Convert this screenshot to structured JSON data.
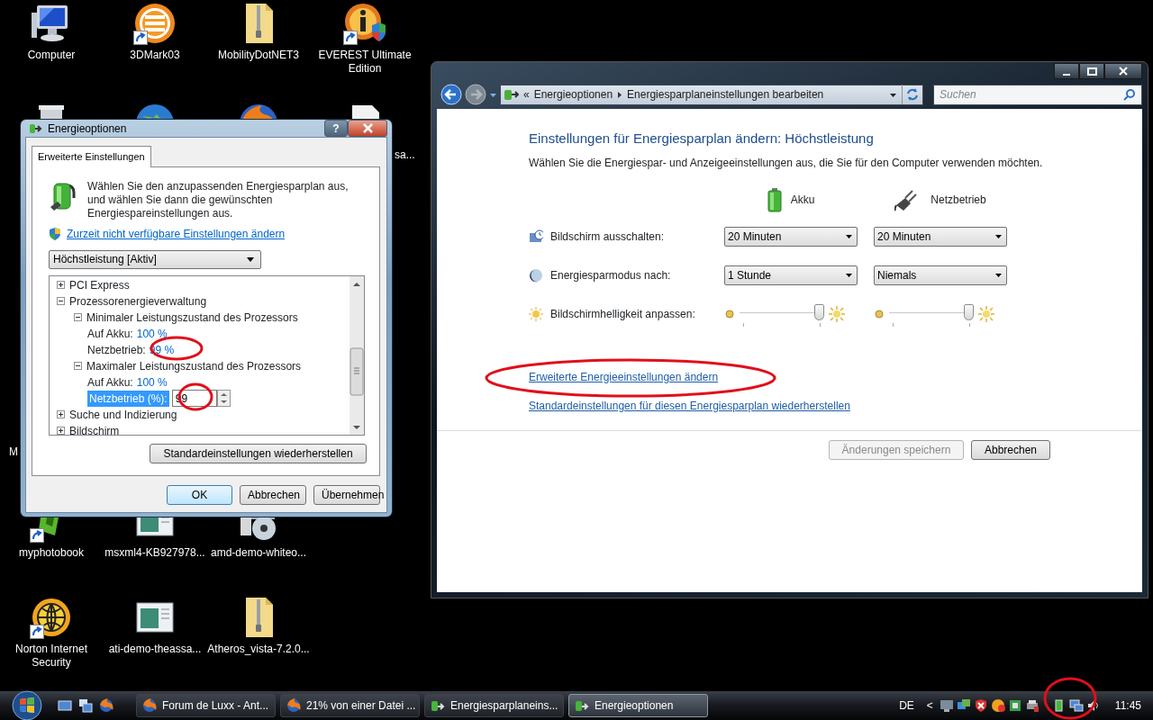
{
  "desktop": {
    "icons": [
      {
        "label": "Computer",
        "shortcut": false
      },
      {
        "label": "3DMark03",
        "shortcut": true
      },
      {
        "label": "MobilityDotNET3",
        "shortcut": false
      },
      {
        "label": "EVEREST Ultimate Edition",
        "shortcut": true
      },
      {
        "label": "myphotobook",
        "shortcut": true
      },
      {
        "label": "msxml4-KB927978...",
        "shortcut": false
      },
      {
        "label": "amd-demo-whiteo...",
        "shortcut": false
      },
      {
        "label": "Norton Internet Security",
        "shortcut": true
      },
      {
        "label": "ati-demo-theassa...",
        "shortcut": false
      },
      {
        "label": "Atheros_vista-7.2.0...",
        "shortcut": false
      }
    ],
    "label_fragments": [
      "sa...",
      "M"
    ]
  },
  "dialog": {
    "title": "Energieoptionen",
    "help_button": "?",
    "tabs": [
      {
        "label": "Erweiterte Einstellungen",
        "selected": true
      }
    ],
    "description": "Wählen Sie den anzupassenden Energiesparplan aus, und wählen Sie dann die gewünschten Energiespareinstellungen aus.",
    "admin_link": "Zurzeit nicht verfügbare Einstellungen ändern",
    "plan_select": "Höchstleistung [Aktiv]",
    "tree": [
      {
        "label": "PCI Express",
        "expanded": false,
        "selected": false
      },
      {
        "label": "Prozessorenergieverwaltung",
        "expanded": true,
        "selected": false,
        "children": [
          {
            "label": "Minimaler Leistungszustand des Prozessors",
            "expanded": true,
            "selected": false,
            "children": [
              {
                "label": "Auf Akku:",
                "value": "100 %",
                "selected": false
              },
              {
                "label": "Netzbetrieb:",
                "value": "99 %",
                "selected": false
              }
            ]
          },
          {
            "label": "Maximaler Leistungszustand des Prozessors",
            "expanded": true,
            "selected": false,
            "children": [
              {
                "label": "Auf Akku:",
                "value": "100 %",
                "selected": false
              },
              {
                "label": "Netzbetrieb (%):",
                "input": "99",
                "selected": true
              }
            ]
          }
        ]
      },
      {
        "label": "Suche und Indizierung",
        "expanded": false,
        "selected": false
      },
      {
        "label": "Bildschirm",
        "expanded": false,
        "selected": false
      }
    ],
    "restore_button": "Standardeinstellungen wiederherstellen",
    "buttons": [
      {
        "label": "OK",
        "default": true
      },
      {
        "label": "Abbrechen",
        "default": false
      },
      {
        "label": "Übernehmen",
        "default": false
      }
    ]
  },
  "window": {
    "breadcrumb_prefix": "«",
    "breadcrumbs": [
      "Energieoptionen",
      "Energiesparplaneinstellungen bearbeiten"
    ],
    "search": {
      "placeholder": "Suchen"
    },
    "heading": "Einstellungen für Energiesparplan ändern: Höchstleistung",
    "subtitle": "Wählen Sie die Energiespar- und Anzeigeeinstellungen aus, die Sie für den Computer verwenden möchten.",
    "columns": [
      "Akku",
      "Netzbetrieb"
    ],
    "settings": [
      {
        "label": "Bildschirm ausschalten:",
        "kind": "select",
        "values": [
          "20 Minuten",
          "20 Minuten"
        ]
      },
      {
        "label": "Energiesparmodus nach:",
        "kind": "select",
        "values": [
          "1 Stunde",
          "Niemals"
        ]
      },
      {
        "label": "Bildschirmhelligkeit anpassen:",
        "kind": "slider",
        "levels": [
          {
            "level": 1.0
          },
          {
            "level": 1.0
          }
        ]
      }
    ],
    "links": [
      "Erweiterte Energieeinstellungen ändern",
      "Standardeinstellungen für diesen Energiesparplan wiederherstellen"
    ],
    "buttons": [
      {
        "label": "Änderungen speichern",
        "disabled": true
      },
      {
        "label": "Abbrechen",
        "disabled": false
      }
    ]
  },
  "annotations": [
    {
      "kind": "ellipse"
    },
    {
      "kind": "ellipse"
    },
    {
      "kind": "ellipse"
    },
    {
      "kind": "ellipse"
    }
  ],
  "taskbar": {
    "tasks": [
      {
        "label": "Forum de Luxx - Ant...",
        "selected": false
      },
      {
        "label": "21% von einer Datei ...",
        "selected": false
      },
      {
        "label": "Energiesparplaneins...",
        "selected": false
      },
      {
        "label": "Energieoptionen",
        "selected": true
      }
    ],
    "language": "DE",
    "tray_expand": "<",
    "clock": "11:45"
  }
}
